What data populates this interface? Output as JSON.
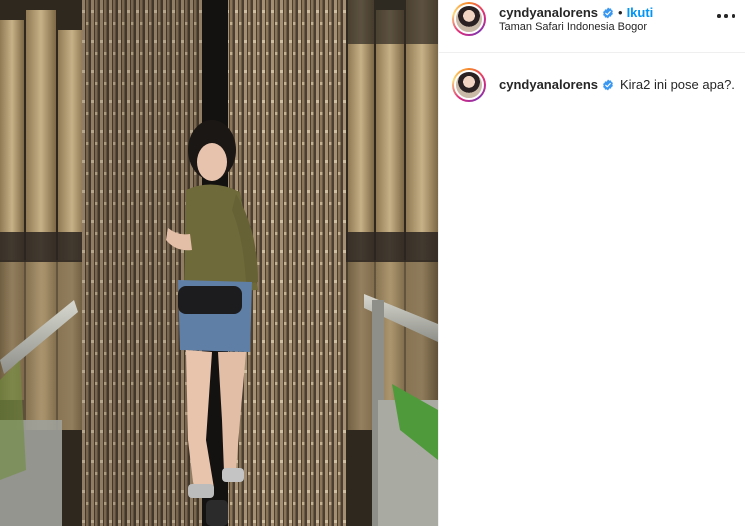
{
  "post": {
    "username": "cyndyanalorens",
    "separator": "•",
    "follow_label": "Ikuti",
    "location": "Taman Safari Indonesia Bogor"
  },
  "caption": {
    "username": "cyndyanalorens",
    "text": "Kira2 ini pose apa?."
  },
  "colors": {
    "verified": "#3897f0",
    "follow": "#0095f6",
    "text": "#262626"
  },
  "icons": {
    "verified": "verified-badge-icon",
    "more": "more-options-icon"
  }
}
